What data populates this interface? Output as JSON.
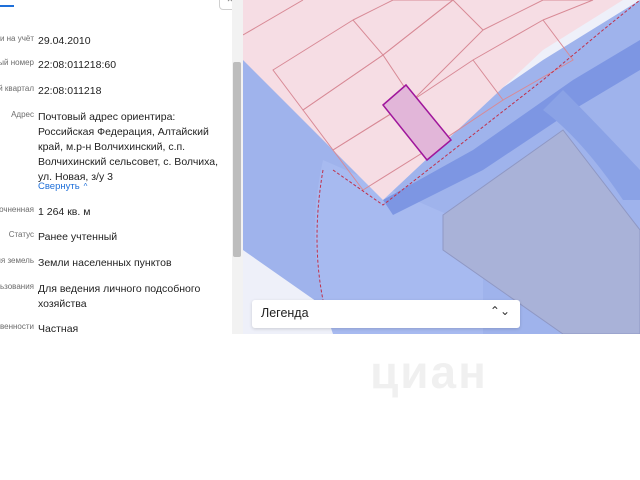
{
  "panel": {
    "rows": [
      {
        "label": "Дата постановки на учёт",
        "value": "29.04.2010"
      },
      {
        "label": "Кадастровый номер",
        "value": "22:08:011218:60"
      },
      {
        "label": "Кадастровый квартал",
        "value": "22:08:011218"
      },
      {
        "label": "Адрес",
        "value": "Почтовый адрес ориентира: Российская Федерация, Алтайский край, м.р-н Волчихинский, с.п. Волчихинский сельсовет, с. Волчиха, ул. Новая, з/у 3"
      },
      {
        "label": "Уточненная",
        "value": "1 264 кв. м"
      },
      {
        "label": "Статус",
        "value": "Ранее учтенный"
      },
      {
        "label": "Категория земель",
        "value": "Земли населенных пунктов"
      },
      {
        "label": "Вид разрешенного использования",
        "value": "Для ведения личного подсобного хозяйства"
      },
      {
        "label": "Форма собственности",
        "value": "Частная"
      }
    ],
    "collapse_label": "Свернуть",
    "collapse_icon": "chevron-up-icon"
  },
  "map": {
    "legend_label": "Легенда",
    "legend_icon": "chevron-up-down-icon",
    "colors": {
      "background": "#eef0f9",
      "zone_blue": "#8fa8e8",
      "zone_blue_dark": "#6f8fdf",
      "parcel_fill": "#f6dde4",
      "parcel_stroke": "#d88a96",
      "selected_fill": "#e2b6d9",
      "selected_stroke": "#a0169c",
      "boundary": "#c0304a",
      "grey_block": "#a8b1d6"
    }
  },
  "watermark": "циан"
}
